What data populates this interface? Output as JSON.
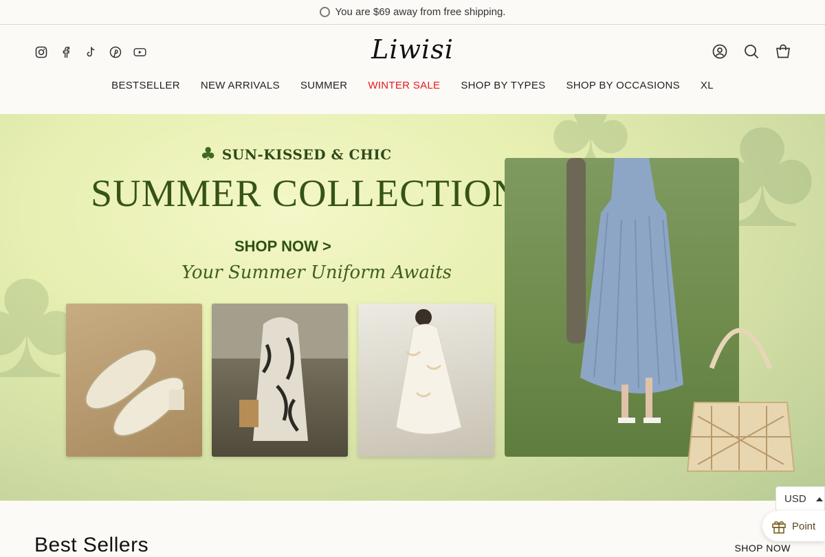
{
  "announcement": {
    "text": "You are $69 away from free shipping."
  },
  "header": {
    "logo": "Liwisi",
    "social_icons": [
      "instagram-icon",
      "facebook-icon",
      "tiktok-icon",
      "pinterest-icon",
      "youtube-icon"
    ],
    "tool_icons": [
      "account-icon",
      "search-icon",
      "cart-icon"
    ]
  },
  "nav": {
    "items": [
      {
        "label": "BESTSELLER"
      },
      {
        "label": "NEW ARRIVALS"
      },
      {
        "label": "SUMMER"
      },
      {
        "label": "WINTER SALE",
        "color": "#e8171b"
      },
      {
        "label": "SHOP BY TYPES"
      },
      {
        "label": "SHOP BY OCCASIONS"
      },
      {
        "label": "XL"
      }
    ]
  },
  "hero": {
    "tagline": "SUN-KISSED & CHIC",
    "title": "SUMMER COLLECTION",
    "cta": "SHOP NOW >",
    "script": "Your Summer Uniform Awaits"
  },
  "section": {
    "title": "Best Sellers",
    "link": "SHOP NOW"
  },
  "currency": {
    "value": "USD"
  },
  "rewards": {
    "label": "Point"
  },
  "colors": {
    "accent_sale": "#e8171b",
    "hero_text": "#355415"
  }
}
